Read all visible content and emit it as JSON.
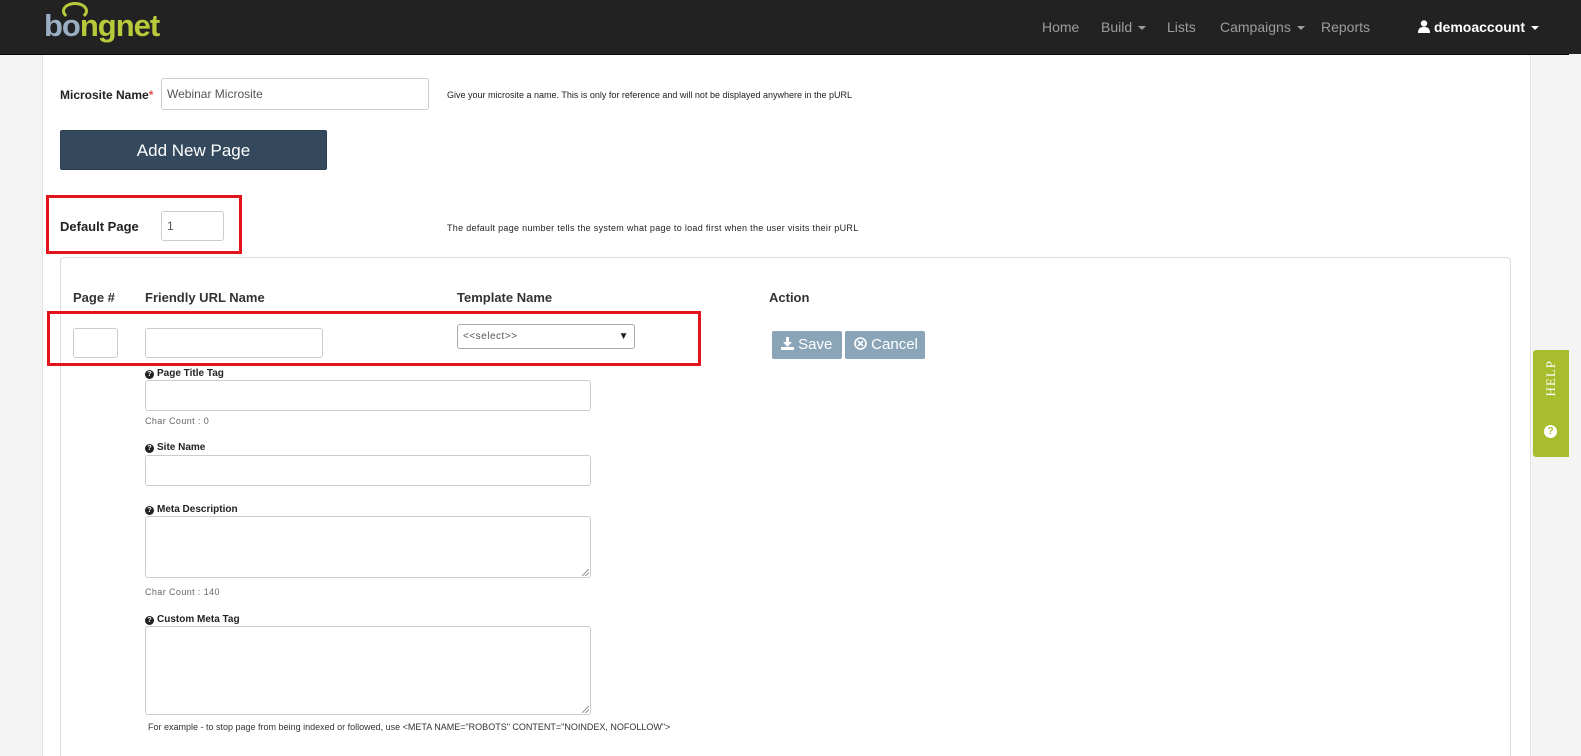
{
  "nav": {
    "logo_left": "bo",
    "logo_right": "ngnet",
    "items": [
      "Home",
      "Build",
      "Lists",
      "Campaigns",
      "Reports"
    ],
    "user": "demoaccount"
  },
  "microsite": {
    "label": "Microsite Name",
    "required_mark": "*",
    "value": "Webinar Microsite",
    "hint": "Give your microsite a name. This is only for reference and will not be displayed anywhere in the pURL"
  },
  "add_page_button": "Add New Page",
  "default_page": {
    "label": "Default Page",
    "value": "1",
    "hint": "The default page number tells the system what page to load first when the user visits their pURL"
  },
  "table": {
    "headers": [
      "Page #",
      "Friendly URL Name",
      "Template Name",
      "Action"
    ],
    "page_num_value": "",
    "friendly_url_value": "",
    "template_selected": "<<select>>",
    "save_label": "Save",
    "cancel_label": "Cancel"
  },
  "fields": {
    "page_title_label": "Page Title Tag",
    "page_title_count": "Char Count : 0",
    "site_name_label": "Site Name",
    "meta_desc_label": "Meta Description",
    "meta_desc_count": "Char Count : 140",
    "custom_meta_label": "Custom Meta Tag",
    "custom_meta_hint": "For example - to stop page from being indexed or followed, use <META NAME=\"ROBOTS\" CONTENT=\"NOINDEX, NOFOLLOW\">"
  },
  "help_tab": "HELP",
  "colors": {
    "navbar": "#222222",
    "add_button": "#34495e",
    "action_button": "#8aa4b8",
    "highlight": "#e3131b",
    "help_tab": "#a8bd2e"
  }
}
